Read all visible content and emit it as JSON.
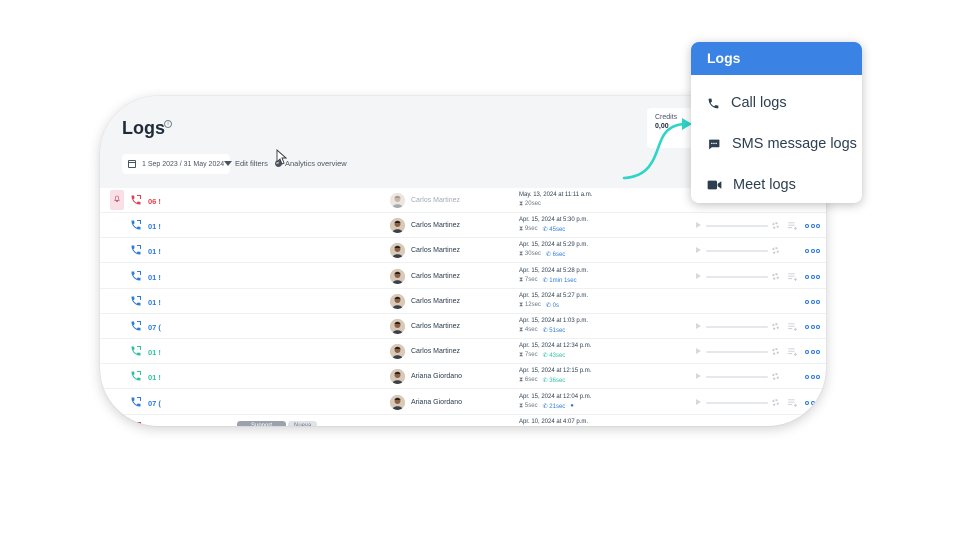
{
  "page": {
    "title": "Logs",
    "date_range": "1 Sep 2023 / 31 May 2024",
    "edit_filters_label": "Edit filters",
    "analytics_label": "Analytics overview",
    "credits_label": "Credits",
    "credits_value": "0,00"
  },
  "rows": [
    {
      "number": "06 !",
      "type": "missed",
      "agent": "Carlos Martinez",
      "faded": true,
      "date": "May. 13, 2024 at 11:11 a.m.",
      "wait": "20sec",
      "ring": "",
      "player": false,
      "queue": false,
      "dots": false
    },
    {
      "number": "01 !",
      "type": "outbound",
      "agent": "Carlos Martinez",
      "faded": false,
      "date": "Apr. 15, 2024 at 5:30 p.m.",
      "wait": "9sec",
      "ring": "45sec",
      "player": true,
      "queue": true,
      "dots": true
    },
    {
      "number": "01 !",
      "type": "outbound",
      "agent": "Carlos Martinez",
      "faded": false,
      "date": "Apr. 15, 2024 at 5:29 p.m.",
      "wait": "30sec",
      "ring": "6sec",
      "player": true,
      "queue": false,
      "dots": true
    },
    {
      "number": "01 !",
      "type": "outbound",
      "agent": "Carlos Martinez",
      "faded": false,
      "date": "Apr. 15, 2024 at 5:28 p.m.",
      "wait": "7sec",
      "ring": "1min 1sec",
      "player": true,
      "queue": true,
      "dots": true
    },
    {
      "number": "01 !",
      "type": "outbound",
      "agent": "Carlos Martinez",
      "faded": false,
      "date": "Apr. 15, 2024 at 5:27 p.m.",
      "wait": "12sec",
      "ring": "0s",
      "player": false,
      "queue": false,
      "dots": true
    },
    {
      "number": "07 (",
      "type": "outbound",
      "agent": "Carlos Martinez",
      "faded": false,
      "date": "Apr. 15, 2024 at 1:03 p.m.",
      "wait": "4sec",
      "ring": "51sec",
      "player": true,
      "queue": true,
      "dots": true
    },
    {
      "number": "01 !",
      "type": "inbound",
      "agent": "Carlos Martinez",
      "faded": false,
      "date": "Apr. 15, 2024 at 12:34 p.m.",
      "wait": "7sec",
      "ring": "43sec",
      "player": true,
      "queue": true,
      "dots": true
    },
    {
      "number": "01 !",
      "type": "inbound",
      "agent": "Ariana Giordano",
      "faded": false,
      "date": "Apr. 15, 2024 at 12:15 p.m.",
      "wait": "6sec",
      "ring": "36sec",
      "player": true,
      "queue": false,
      "dots": true
    },
    {
      "number": "07 (",
      "type": "outbound",
      "agent": "Ariana Giordano",
      "faded": false,
      "date": "Apr. 15, 2024 at 12:04 p.m.",
      "wait": "5sec",
      "ring": "21sec",
      "player": true,
      "queue": true,
      "dots": true
    },
    {
      "number": "06 !",
      "type": "missed",
      "agent": "",
      "faded": false,
      "date": "Apr. 10, 2024 at 4:07 p.m.",
      "wait": "",
      "ring": "",
      "player": false,
      "queue": false,
      "dots": false,
      "tags": [
        "Support",
        "Nueva"
      ]
    }
  ],
  "dropdown": {
    "title": "Logs",
    "items": [
      {
        "label": "Call logs",
        "icon": "phone-icon"
      },
      {
        "label": "SMS message logs",
        "icon": "chat-icon"
      },
      {
        "label": "Meet logs",
        "icon": "video-icon"
      }
    ]
  },
  "colors": {
    "accent": "#3b82e5",
    "missed": "#e0434f",
    "inbound": "#2fc1a6",
    "arrow": "#2dd4c8"
  }
}
